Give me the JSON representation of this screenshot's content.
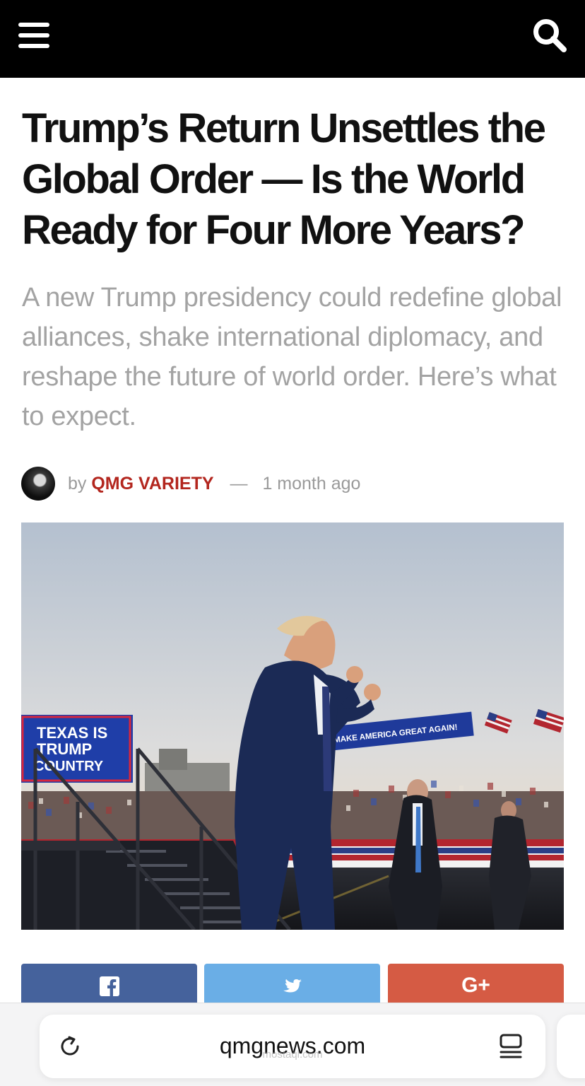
{
  "header": {
    "menu_icon": "hamburger-menu-icon",
    "search_icon": "search-icon",
    "background": "#000000"
  },
  "article": {
    "title": "Trump’s Return Unsettles the Global Order — Is the World Ready for Four More Years?",
    "subtitle": "A new Trump presidency could redefine global alliances, shake international diplomacy, and reshape the future of world order. Here’s what to expect.",
    "byline_prefix": "by",
    "author": "QMG VARIETY",
    "separator": "—",
    "published": "1 month ago",
    "author_color": "#b3261e"
  },
  "hero_image": {
    "sign_left_lines": [
      "TEXAS IS",
      "TRUMP",
      "COUNTRY"
    ],
    "banner_right": "MAKE AMERICA GREAT AGAIN!"
  },
  "share": {
    "facebook": {
      "icon": "facebook-icon",
      "color": "#45629c"
    },
    "twitter": {
      "icon": "twitter-icon",
      "color": "#6aaee6"
    },
    "google_plus": {
      "icon": "google-plus-icon",
      "label": "G+",
      "color": "#d55b44"
    }
  },
  "browser": {
    "url": "qmgnews.com",
    "watermark": "mostaql.com",
    "reload_icon": "reload-icon",
    "reader_icon": "reader-mode-icon"
  }
}
